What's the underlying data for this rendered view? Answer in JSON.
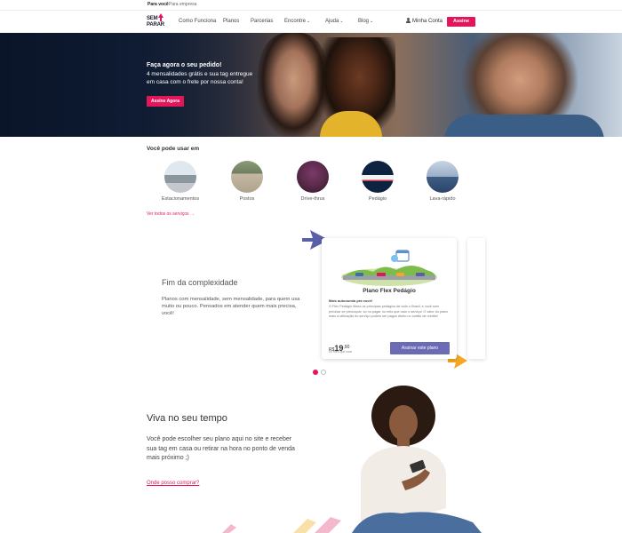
{
  "utility": {
    "personal": "Para você",
    "business": "Para empresa"
  },
  "nav": {
    "logo_line1": "SEM",
    "logo_line2": "PARAR",
    "items": [
      {
        "label": "Como Funciona",
        "dropdown": false
      },
      {
        "label": "Planos",
        "dropdown": false
      },
      {
        "label": "Parcerias",
        "dropdown": false
      },
      {
        "label": "Encontre",
        "dropdown": true
      },
      {
        "label": "Ajuda",
        "dropdown": true
      },
      {
        "label": "Blog",
        "dropdown": true
      }
    ],
    "account": "Minha Conta",
    "cta": "Assine"
  },
  "hero": {
    "title": "Faça agora o seu pedido!",
    "line1": "4 mensalidades grátis e sua tag entregue",
    "line2": "em casa com o frete por nossa conta!",
    "cta": "Assine Agora"
  },
  "services": {
    "title": "Você pode usar em",
    "items": [
      {
        "label": "Estacionamentos"
      },
      {
        "label": "Postos"
      },
      {
        "label": "Drive-thrus"
      },
      {
        "label": "Pedágio"
      },
      {
        "label": "Lava-rápido"
      }
    ],
    "link": "Ver todos os serviços →"
  },
  "complexity": {
    "title": "Fim da complexidade",
    "body": "Planos com mensalidade, sem mensalidade, para quem usa muito ou pouco. Pensados em atender quem mais precisa, você!"
  },
  "plan_card": {
    "title": "Plano Flex Pedágio",
    "subtitle": "Mais autonomia pra você!",
    "description": "O Flex Pedágio libera os principais pedágios de todo o Brasil, e você sem precisar se preocupar, só no pagar no mês que usar o serviço! O valor do plano mais a utilização do serviço podem ser pagos direto no cartão de crédito!",
    "currency": "R$",
    "price_int": "19",
    "price_cents": ",90",
    "price_note": "no mês que usar",
    "cta": "Assinar este plano"
  },
  "carousel": {
    "pages": 2,
    "active": 1
  },
  "viva": {
    "title": "Viva no seu tempo",
    "body": "Você pode escolher seu plano aqui no site e receber sua tag em casa ou retirar na hora no ponto de venda mais próximo ;)",
    "link": "Onde posso comprar?"
  },
  "colors": {
    "brand_pink": "#e3165b",
    "plan_purple": "#6b6bb5",
    "arrow_purple": "#5b5fa8",
    "arrow_yellow": "#f5a623",
    "hero_dark": "#0d1b33"
  }
}
